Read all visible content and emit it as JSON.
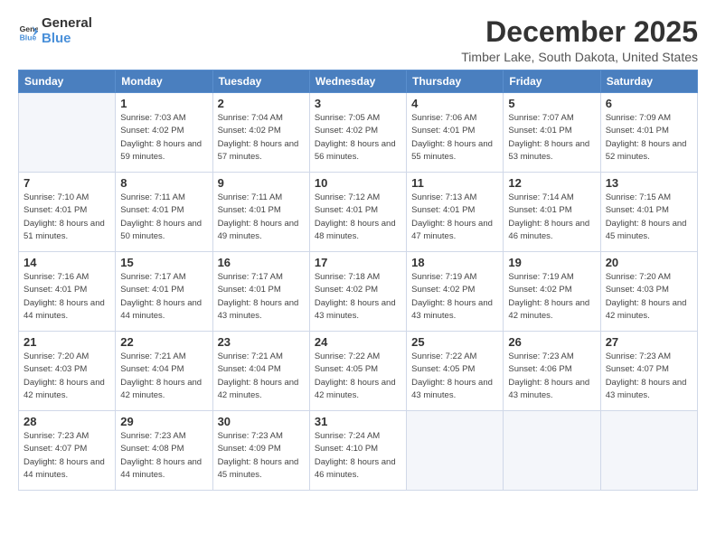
{
  "logo": {
    "general": "General",
    "blue": "Blue"
  },
  "title": "December 2025",
  "location": "Timber Lake, South Dakota, United States",
  "weekdays": [
    "Sunday",
    "Monday",
    "Tuesday",
    "Wednesday",
    "Thursday",
    "Friday",
    "Saturday"
  ],
  "weeks": [
    [
      {
        "day": "",
        "sunrise": "",
        "sunset": "",
        "daylight": ""
      },
      {
        "day": "1",
        "sunrise": "Sunrise: 7:03 AM",
        "sunset": "Sunset: 4:02 PM",
        "daylight": "Daylight: 8 hours and 59 minutes."
      },
      {
        "day": "2",
        "sunrise": "Sunrise: 7:04 AM",
        "sunset": "Sunset: 4:02 PM",
        "daylight": "Daylight: 8 hours and 57 minutes."
      },
      {
        "day": "3",
        "sunrise": "Sunrise: 7:05 AM",
        "sunset": "Sunset: 4:02 PM",
        "daylight": "Daylight: 8 hours and 56 minutes."
      },
      {
        "day": "4",
        "sunrise": "Sunrise: 7:06 AM",
        "sunset": "Sunset: 4:01 PM",
        "daylight": "Daylight: 8 hours and 55 minutes."
      },
      {
        "day": "5",
        "sunrise": "Sunrise: 7:07 AM",
        "sunset": "Sunset: 4:01 PM",
        "daylight": "Daylight: 8 hours and 53 minutes."
      },
      {
        "day": "6",
        "sunrise": "Sunrise: 7:09 AM",
        "sunset": "Sunset: 4:01 PM",
        "daylight": "Daylight: 8 hours and 52 minutes."
      }
    ],
    [
      {
        "day": "7",
        "sunrise": "Sunrise: 7:10 AM",
        "sunset": "Sunset: 4:01 PM",
        "daylight": "Daylight: 8 hours and 51 minutes."
      },
      {
        "day": "8",
        "sunrise": "Sunrise: 7:11 AM",
        "sunset": "Sunset: 4:01 PM",
        "daylight": "Daylight: 8 hours and 50 minutes."
      },
      {
        "day": "9",
        "sunrise": "Sunrise: 7:11 AM",
        "sunset": "Sunset: 4:01 PM",
        "daylight": "Daylight: 8 hours and 49 minutes."
      },
      {
        "day": "10",
        "sunrise": "Sunrise: 7:12 AM",
        "sunset": "Sunset: 4:01 PM",
        "daylight": "Daylight: 8 hours and 48 minutes."
      },
      {
        "day": "11",
        "sunrise": "Sunrise: 7:13 AM",
        "sunset": "Sunset: 4:01 PM",
        "daylight": "Daylight: 8 hours and 47 minutes."
      },
      {
        "day": "12",
        "sunrise": "Sunrise: 7:14 AM",
        "sunset": "Sunset: 4:01 PM",
        "daylight": "Daylight: 8 hours and 46 minutes."
      },
      {
        "day": "13",
        "sunrise": "Sunrise: 7:15 AM",
        "sunset": "Sunset: 4:01 PM",
        "daylight": "Daylight: 8 hours and 45 minutes."
      }
    ],
    [
      {
        "day": "14",
        "sunrise": "Sunrise: 7:16 AM",
        "sunset": "Sunset: 4:01 PM",
        "daylight": "Daylight: 8 hours and 44 minutes."
      },
      {
        "day": "15",
        "sunrise": "Sunrise: 7:17 AM",
        "sunset": "Sunset: 4:01 PM",
        "daylight": "Daylight: 8 hours and 44 minutes."
      },
      {
        "day": "16",
        "sunrise": "Sunrise: 7:17 AM",
        "sunset": "Sunset: 4:01 PM",
        "daylight": "Daylight: 8 hours and 43 minutes."
      },
      {
        "day": "17",
        "sunrise": "Sunrise: 7:18 AM",
        "sunset": "Sunset: 4:02 PM",
        "daylight": "Daylight: 8 hours and 43 minutes."
      },
      {
        "day": "18",
        "sunrise": "Sunrise: 7:19 AM",
        "sunset": "Sunset: 4:02 PM",
        "daylight": "Daylight: 8 hours and 43 minutes."
      },
      {
        "day": "19",
        "sunrise": "Sunrise: 7:19 AM",
        "sunset": "Sunset: 4:02 PM",
        "daylight": "Daylight: 8 hours and 42 minutes."
      },
      {
        "day": "20",
        "sunrise": "Sunrise: 7:20 AM",
        "sunset": "Sunset: 4:03 PM",
        "daylight": "Daylight: 8 hours and 42 minutes."
      }
    ],
    [
      {
        "day": "21",
        "sunrise": "Sunrise: 7:20 AM",
        "sunset": "Sunset: 4:03 PM",
        "daylight": "Daylight: 8 hours and 42 minutes."
      },
      {
        "day": "22",
        "sunrise": "Sunrise: 7:21 AM",
        "sunset": "Sunset: 4:04 PM",
        "daylight": "Daylight: 8 hours and 42 minutes."
      },
      {
        "day": "23",
        "sunrise": "Sunrise: 7:21 AM",
        "sunset": "Sunset: 4:04 PM",
        "daylight": "Daylight: 8 hours and 42 minutes."
      },
      {
        "day": "24",
        "sunrise": "Sunrise: 7:22 AM",
        "sunset": "Sunset: 4:05 PM",
        "daylight": "Daylight: 8 hours and 42 minutes."
      },
      {
        "day": "25",
        "sunrise": "Sunrise: 7:22 AM",
        "sunset": "Sunset: 4:05 PM",
        "daylight": "Daylight: 8 hours and 43 minutes."
      },
      {
        "day": "26",
        "sunrise": "Sunrise: 7:23 AM",
        "sunset": "Sunset: 4:06 PM",
        "daylight": "Daylight: 8 hours and 43 minutes."
      },
      {
        "day": "27",
        "sunrise": "Sunrise: 7:23 AM",
        "sunset": "Sunset: 4:07 PM",
        "daylight": "Daylight: 8 hours and 43 minutes."
      }
    ],
    [
      {
        "day": "28",
        "sunrise": "Sunrise: 7:23 AM",
        "sunset": "Sunset: 4:07 PM",
        "daylight": "Daylight: 8 hours and 44 minutes."
      },
      {
        "day": "29",
        "sunrise": "Sunrise: 7:23 AM",
        "sunset": "Sunset: 4:08 PM",
        "daylight": "Daylight: 8 hours and 44 minutes."
      },
      {
        "day": "30",
        "sunrise": "Sunrise: 7:23 AM",
        "sunset": "Sunset: 4:09 PM",
        "daylight": "Daylight: 8 hours and 45 minutes."
      },
      {
        "day": "31",
        "sunrise": "Sunrise: 7:24 AM",
        "sunset": "Sunset: 4:10 PM",
        "daylight": "Daylight: 8 hours and 46 minutes."
      },
      {
        "day": "",
        "sunrise": "",
        "sunset": "",
        "daylight": ""
      },
      {
        "day": "",
        "sunrise": "",
        "sunset": "",
        "daylight": ""
      },
      {
        "day": "",
        "sunrise": "",
        "sunset": "",
        "daylight": ""
      }
    ]
  ]
}
